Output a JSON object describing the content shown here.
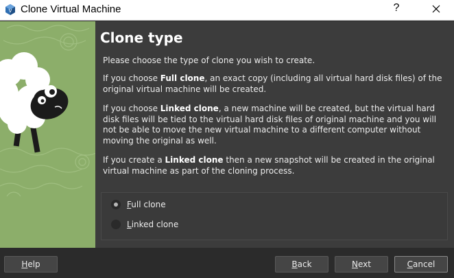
{
  "window": {
    "title": "Clone Virtual Machine",
    "help_glyph": "?",
    "app_icon": "virtualbox-icon",
    "close_icon": "close-icon"
  },
  "page": {
    "heading": "Clone type",
    "intro": "Please choose the type of clone you wish to create.",
    "full_clone_para": {
      "pre": "If you choose ",
      "bold": "Full clone",
      "post": ", an exact copy (including all virtual hard disk files) of the original virtual machine will be created."
    },
    "linked_clone_para": {
      "pre": "If you choose ",
      "bold": "Linked clone",
      "post": ", a new machine will be created, but the virtual hard disk files will be tied to the virtual hard disk files of original machine and you will not be able to move the new virtual machine to a different computer without moving the original as well."
    },
    "snapshot_para": {
      "pre": "If you create a ",
      "bold": "Linked clone",
      "post": " then a new snapshot will be created in the original virtual machine as part of the cloning process."
    }
  },
  "options": {
    "full": {
      "mnemonic": "F",
      "rest": "ull clone",
      "checked": true
    },
    "linked": {
      "mnemonic": "L",
      "rest": "inked clone",
      "checked": false
    }
  },
  "buttons": {
    "help": {
      "mnemonic": "H",
      "rest": "elp"
    },
    "back": {
      "mnemonic": "B",
      "rest": "ack"
    },
    "next": {
      "mnemonic": "N",
      "rest": "ext"
    },
    "cancel": {
      "mnemonic": "C",
      "rest": "ancel"
    }
  },
  "colors": {
    "art_green": "#8cae6a",
    "content_bg": "#3c3c3c",
    "footer_bg": "#2b2b2b"
  }
}
